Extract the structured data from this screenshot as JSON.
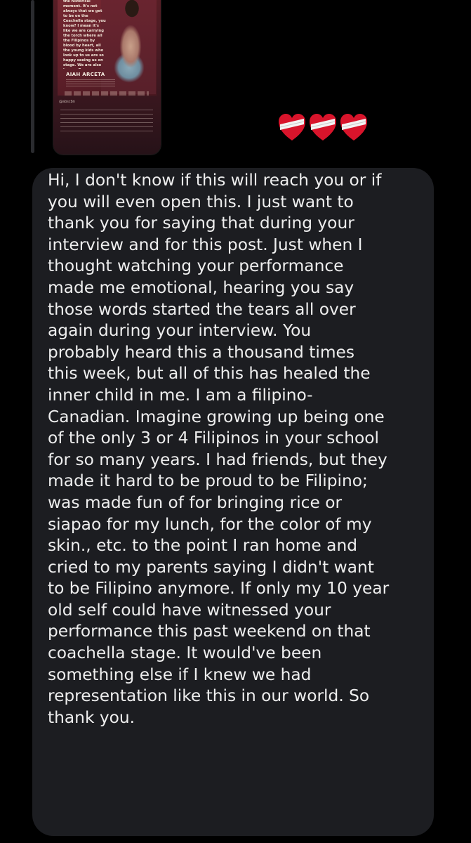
{
  "shared_post": {
    "quote": "We're grateful for the historical moment. It's not always that we get to be on the Coachella stage, you know? I mean it's like we are carrying the torch where all the Filipinos by blood by heart, all the young kids who look up to us are so happy seeing us on stage. We are also happy. Our younger selves, our little kids inside [us] are so happy because you know, we got to bring that light to everybody.",
    "author": "AIAH ARCETA",
    "handle": "@abscbn"
  },
  "reaction": {
    "icons": [
      "mending-heart-icon",
      "mending-heart-icon",
      "mending-heart-icon"
    ]
  },
  "message": {
    "text": "Hi, I don't know if this will reach you or if\nyou will even open this. I just want to\nthank you for saying that during your\ninterview and for this post. Just when I\nthought watching your performance\nmade me emotional, hearing you say\nthose words started the tears all over\nagain during your interview. You\nprobably heard this a thousand times\nthis week, but all of this has healed the\ninner child in me. I am a filipino-\nCanadian. Imagine growing up being one\nof the only 3 or 4 Filipinos in your school\nfor so many years. I had friends, but they\nmade it hard to be proud to be Filipino;\nwas made fun of for bringing rice or\nsiapao for my lunch, for the color of my\nskin., etc. to the point I ran home and\ncried to my parents saying I didn't want\nto be Filipino anymore. If only my 10 year\nold self could have witnessed your\nperformance this past weekend on that\ncoachella stage. It would've been\nsomething else if I knew we had\nrepresentation like this in our world. So\nthank you."
  },
  "colors": {
    "background": "#000000",
    "bubble": "#1c1d21",
    "text": "#eeeeee",
    "heart": "#d8142b"
  }
}
